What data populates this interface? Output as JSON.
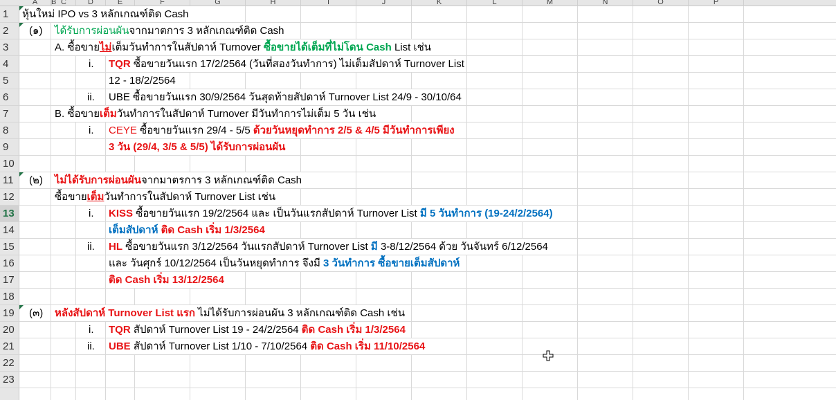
{
  "columns": [
    "A",
    "B",
    "C",
    "D",
    "E",
    "F",
    "G",
    "H",
    "I",
    "J",
    "K",
    "L",
    "M",
    "N",
    "O",
    "P"
  ],
  "rows": [
    {
      "num": "1",
      "cells": [
        {
          "col": "A",
          "runs": [
            {
              "t": "หุ้นใหม่ IPO vs 3 หลักเกณฑ์ติด Cash"
            }
          ]
        }
      ]
    },
    {
      "num": "2",
      "cells": [
        {
          "col": "A",
          "indent": 10,
          "runs": [
            {
              "t": "(๑)"
            }
          ]
        },
        {
          "col": "C",
          "runs": [
            {
              "t": "ได้รับการผ่อนผัน",
              "c": "green"
            },
            {
              "t": "จากมาตการ 3 หลักเกณฑ์ติด Cash"
            }
          ]
        }
      ]
    },
    {
      "num": "3",
      "cells": [
        {
          "col": "C",
          "runs": [
            {
              "t": "A.  ซื้อขาย"
            },
            {
              "t": "ไม่",
              "c": "red",
              "b": true,
              "u": true
            },
            {
              "t": "เต็มวันทำการในสัปดาห์ Turnover "
            },
            {
              "t": "ซื้อขายได้เต็มที่ไม่โดน Cash",
              "c": "green",
              "b": true
            },
            {
              "t": " List เช่น"
            }
          ]
        }
      ]
    },
    {
      "num": "4",
      "cells": [
        {
          "col": "D",
          "indent": 14,
          "runs": [
            {
              "t": "i."
            }
          ]
        },
        {
          "col": "E",
          "runs": [
            {
              "t": "TQR",
              "c": "red",
              "b": true
            },
            {
              "t": " ซื้อขายวันแรก 17/2/2564 (วันที่สองวันทำการ) ไม่เต็มสัปดาห์ Turnover List"
            }
          ]
        }
      ]
    },
    {
      "num": "5",
      "cells": [
        {
          "col": "E",
          "runs": [
            {
              "t": "12 - 18/2/2564"
            }
          ]
        }
      ]
    },
    {
      "num": "6",
      "cells": [
        {
          "col": "D",
          "indent": 12,
          "runs": [
            {
              "t": "ii."
            }
          ]
        },
        {
          "col": "E",
          "runs": [
            {
              "t": "UBE ซื้อขายวันแรก 30/9/2564 วันสุดท้ายสัปดาห์ Turnover List 24/9 - 30/10/64"
            }
          ]
        }
      ]
    },
    {
      "num": "7",
      "cells": [
        {
          "col": "C",
          "runs": [
            {
              "t": "B. ซื้อขาย"
            },
            {
              "t": "เต็ม",
              "c": "red",
              "b": true
            },
            {
              "t": "วันทำการในสัปดาห์ Turnover มีวันทำการไม่เต็ม 5 วัน เช่น"
            }
          ]
        }
      ]
    },
    {
      "num": "8",
      "cells": [
        {
          "col": "D",
          "indent": 14,
          "runs": [
            {
              "t": "i."
            }
          ]
        },
        {
          "col": "E",
          "runs": [
            {
              "t": "CEYE",
              "c": "red"
            },
            {
              "t": " ซื้อขายวันแรก 29/4 - 5/5 "
            },
            {
              "t": "ด้วยวันหยุดทำการ 2/5 & 4/5 มีวันทำการเพียง",
              "c": "red",
              "b": true
            }
          ]
        }
      ]
    },
    {
      "num": "9",
      "cells": [
        {
          "col": "E",
          "runs": [
            {
              "t": "3 วัน (29/4, 3/5 & 5/5) ได้รับการผ่อนผัน",
              "c": "red",
              "b": true
            }
          ]
        }
      ]
    },
    {
      "num": "10",
      "cells": []
    },
    {
      "num": "11",
      "cells": [
        {
          "col": "A",
          "indent": 10,
          "runs": [
            {
              "t": "(๒)"
            }
          ]
        },
        {
          "col": "C",
          "runs": [
            {
              "t": "ไม่ได้รับการผ่อนผัน",
              "c": "red",
              "b": true
            },
            {
              "t": "จากมาตรการ 3 หลักเกณฑ์ติด Cash"
            }
          ]
        }
      ]
    },
    {
      "num": "12",
      "cells": [
        {
          "col": "C",
          "runs": [
            {
              "t": "ซื้อขาย"
            },
            {
              "t": "เต็ม",
              "c": "red",
              "b": true,
              "u": true
            },
            {
              "t": "วันทำการในสัปดาห์ Turnover List เช่น"
            }
          ]
        }
      ]
    },
    {
      "num": "13",
      "selected": true,
      "cells": [
        {
          "col": "D",
          "indent": 14,
          "runs": [
            {
              "t": "i."
            }
          ]
        },
        {
          "col": "E",
          "runs": [
            {
              "t": "KISS",
              "c": "red",
              "b": true
            },
            {
              "t": " ซื้อขายวันแรก 19/2/2564 และ เป็นวันแรกสัปดาห์ Turnover List "
            },
            {
              "t": "มี 5 วันทำการ (19-24/2/2564)",
              "c": "blue",
              "b": true
            }
          ]
        }
      ]
    },
    {
      "num": "14",
      "cells": [
        {
          "col": "E",
          "runs": [
            {
              "t": "เต็มสัปดาห์ ",
              "c": "blue",
              "b": true
            },
            {
              "t": "ติด Cash เริ่ม 1/3/2564",
              "c": "red",
              "b": true
            }
          ]
        }
      ]
    },
    {
      "num": "15",
      "cells": [
        {
          "col": "D",
          "indent": 12,
          "runs": [
            {
              "t": "ii."
            }
          ]
        },
        {
          "col": "E",
          "runs": [
            {
              "t": "HL",
              "c": "red",
              "b": true
            },
            {
              "t": " ซื้อขายวันแรก 3/12/2564 วันแรกสัปดาห์ Turnover List "
            },
            {
              "t": "มี",
              "c": "blue",
              "b": true
            },
            {
              "t": " 3-8/12/2564 ด้วย วันจันทร์ 6/12/2564"
            }
          ]
        }
      ]
    },
    {
      "num": "16",
      "cells": [
        {
          "col": "E",
          "runs": [
            {
              "t": "และ วันศุกร์ 10/12/2564 เป็นวันหยุดทำการ จึงมี "
            },
            {
              "t": "3 วันทำการ ซื้อขายเต็มสัปดาห์",
              "c": "blue",
              "b": true
            }
          ]
        }
      ]
    },
    {
      "num": "17",
      "cells": [
        {
          "col": "E",
          "runs": [
            {
              "t": "ติด Cash เริ่ม 13/12/2564",
              "c": "red",
              "b": true
            }
          ]
        }
      ]
    },
    {
      "num": "18",
      "cells": []
    },
    {
      "num": "19",
      "cells": [
        {
          "col": "A",
          "indent": 10,
          "runs": [
            {
              "t": "(๓)"
            }
          ]
        },
        {
          "col": "C",
          "runs": [
            {
              "t": "หลังสัปดาห์ Turnover List แรก",
              "c": "red",
              "b": true
            },
            {
              "t": " ไม่ได้รับการผ่อนผัน 3 หลักเกณฑ์ติด Cash เช่น"
            }
          ]
        }
      ]
    },
    {
      "num": "20",
      "cells": [
        {
          "col": "D",
          "indent": 14,
          "runs": [
            {
              "t": "i."
            }
          ]
        },
        {
          "col": "E",
          "runs": [
            {
              "t": "TQR",
              "c": "red",
              "b": true
            },
            {
              "t": " สัปดาห์ Turnover List 19 - 24/2/2564 "
            },
            {
              "t": "ติด Cash เริ่ม 1/3/2564",
              "c": "red",
              "b": true
            }
          ]
        }
      ]
    },
    {
      "num": "21",
      "cells": [
        {
          "col": "D",
          "indent": 12,
          "runs": [
            {
              "t": "ii."
            }
          ]
        },
        {
          "col": "E",
          "runs": [
            {
              "t": "UBE",
              "c": "red",
              "b": true
            },
            {
              "t": " สัปดาห์ Turnover List  1/10 - 7/10/2564  "
            },
            {
              "t": "ติด Cash เริ่ม 11/10/2564",
              "c": "red",
              "b": true
            }
          ]
        }
      ]
    },
    {
      "num": "22",
      "cells": []
    },
    {
      "num": "23",
      "cells": []
    }
  ],
  "comment_marker_rows": [
    "2",
    "11",
    "19"
  ],
  "colors": {
    "green": "#00a651",
    "red": "#e81416",
    "blue": "#0070c0",
    "selected_row_header": "#217346"
  },
  "cursor_icon": "crosshair-plus-cursor-icon"
}
